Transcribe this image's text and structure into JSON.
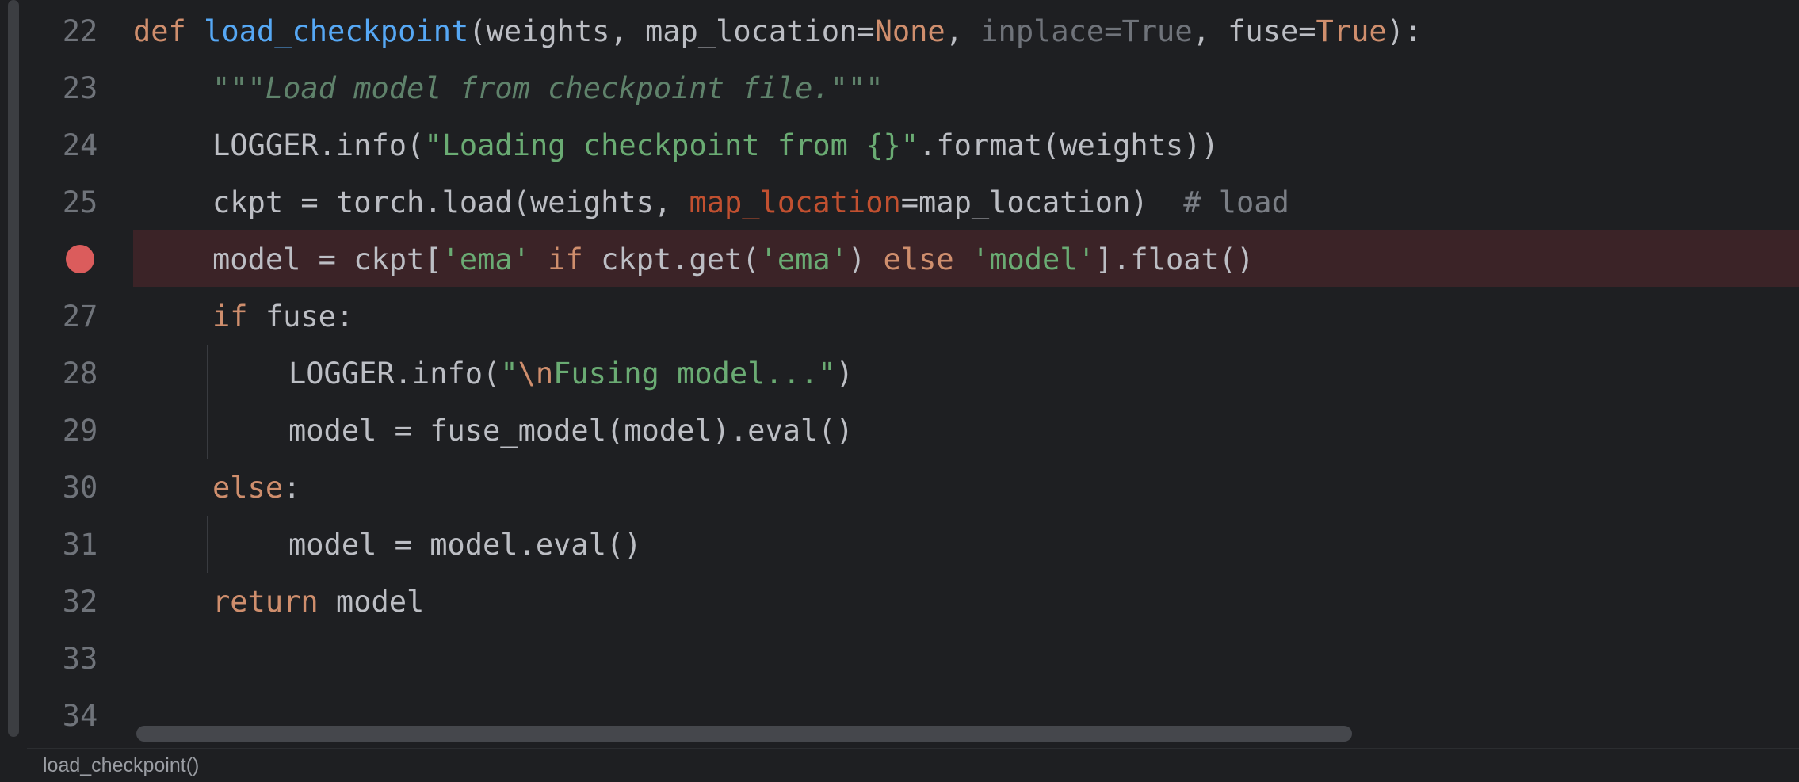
{
  "gutter": {
    "line_numbers": [
      "22",
      "23",
      "24",
      "25",
      "",
      "27",
      "28",
      "29",
      "30",
      "31",
      "32",
      "33",
      "34"
    ],
    "breakpoint_line": "26"
  },
  "code": {
    "l22": {
      "t1": "def ",
      "t2": "load_checkpoint",
      "t3": "(weights, map_location=",
      "t4": "None",
      "t5": ", ",
      "t6": "inplace=True",
      "t7": ", fuse=",
      "t8": "True",
      "t9": "):"
    },
    "l23": {
      "t1": "\"\"\"Load model from checkpoint file.\"\"\""
    },
    "l24": {
      "t1": "LOGGER.info(",
      "t2": "\"Loading checkpoint from {}\"",
      "t3": ".format(weights))"
    },
    "l25": {
      "t1": "ckpt = torch.load(weights, ",
      "t2": "map_location",
      "t3": "=map_location)  ",
      "t4": "# load"
    },
    "l26": {
      "t1": "model = ckpt[",
      "t2": "'ema'",
      "t3": " ",
      "t4": "if",
      "t5": " ckpt.get(",
      "t6": "'ema'",
      "t7": ") ",
      "t8": "else",
      "t9": " ",
      "t10": "'model'",
      "t11": "].float()"
    },
    "l27": {
      "t1": "if",
      "t2": " fuse:"
    },
    "l28": {
      "t1": "LOGGER.info(",
      "t2": "\"",
      "t3": "\\n",
      "t4": "Fusing model...\"",
      "t5": ")"
    },
    "l29": {
      "t1": "model = fuse_model(model).eval()"
    },
    "l30": {
      "t1": "else",
      "t2": ":"
    },
    "l31": {
      "t1": "model = model.eval()"
    },
    "l32": {
      "t1": "return",
      "t2": " model"
    }
  },
  "status": {
    "breadcrumb": "load_checkpoint()"
  },
  "colors": {
    "background": "#1e1f22",
    "keyword": "#cf8e6d",
    "function": "#56a8f5",
    "string": "#6aab73",
    "breakpoint": "#db5c5c",
    "breakpoint_line_bg": "#3b2327"
  }
}
